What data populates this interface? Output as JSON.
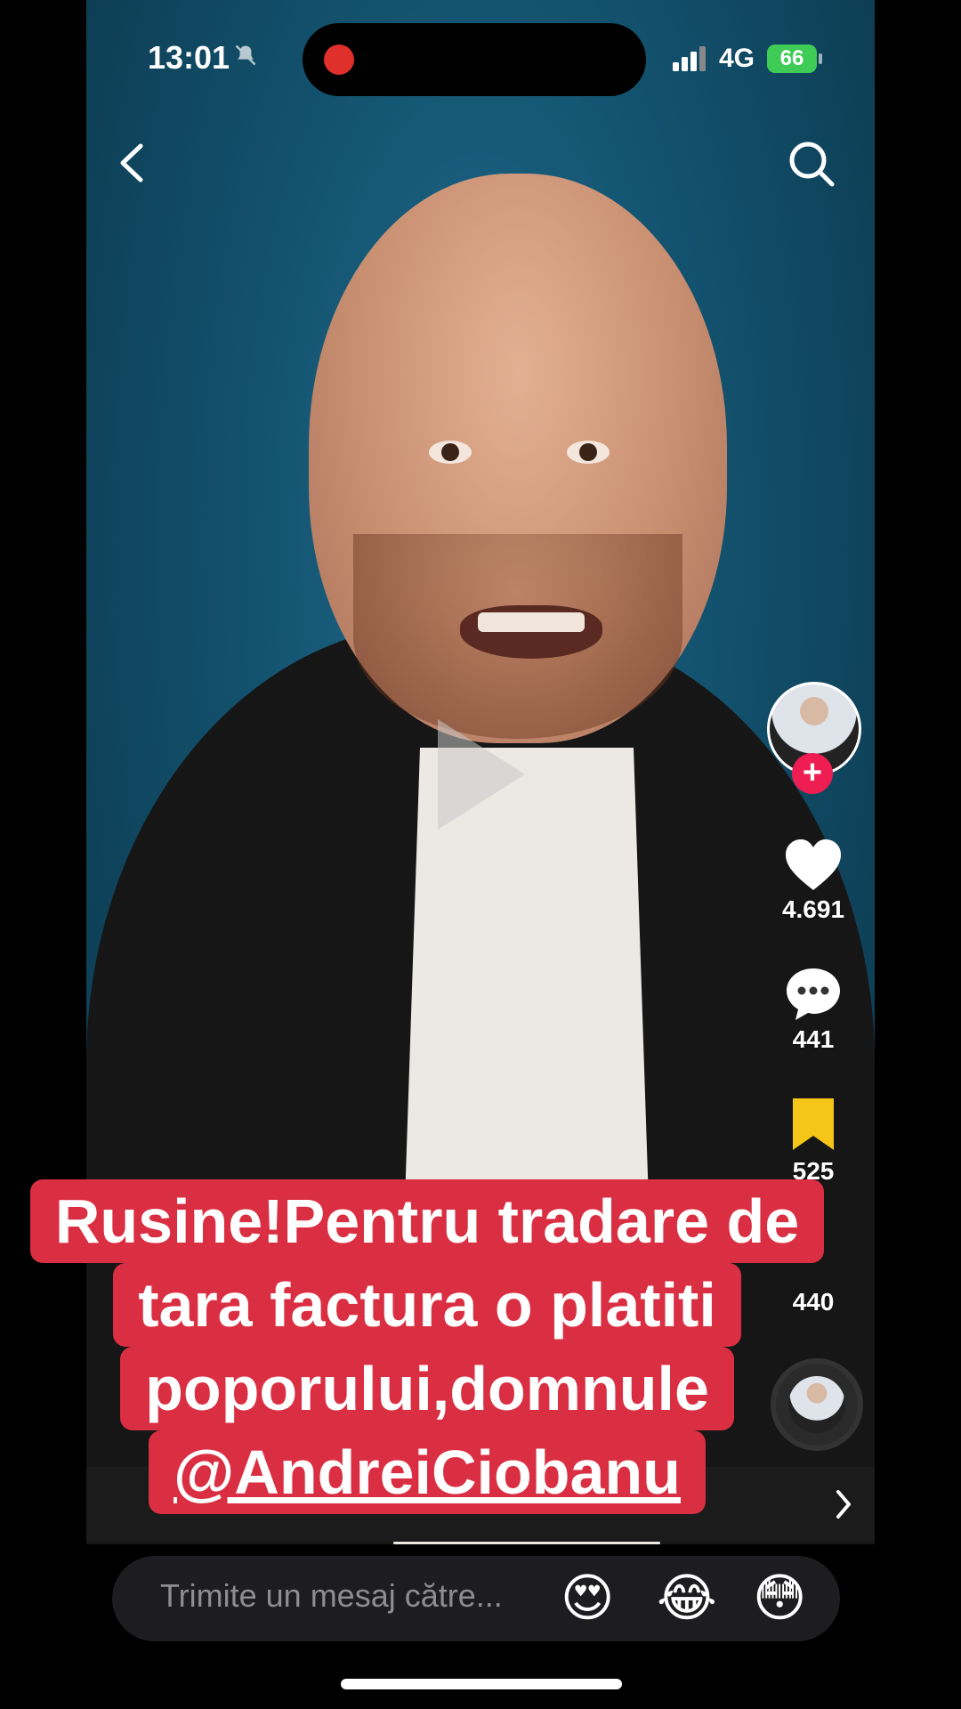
{
  "status_bar": {
    "time": "13:01",
    "network": "4G",
    "battery": "66"
  },
  "nav": {
    "back_icon": "back-arrow-icon",
    "search_icon": "search-icon"
  },
  "rail": {
    "likes": "4.691",
    "comments": "441",
    "bookmarks": "525",
    "shares": "440"
  },
  "caption": {
    "line1": "Rusine!Pentru tradare de",
    "line2": "tara factura o platiti",
    "line3": "poporului,domnule",
    "mention": "@AndreiCiobanu"
  },
  "message_bar": {
    "placeholder": "Trimite un mesaj către...",
    "emojis": [
      "😍",
      "😂",
      "😳"
    ]
  },
  "colors": {
    "accent": "#ee1d52",
    "caption_bg": "#da2f42",
    "bookmark": "#f5c518",
    "battery": "#3ecc56"
  }
}
